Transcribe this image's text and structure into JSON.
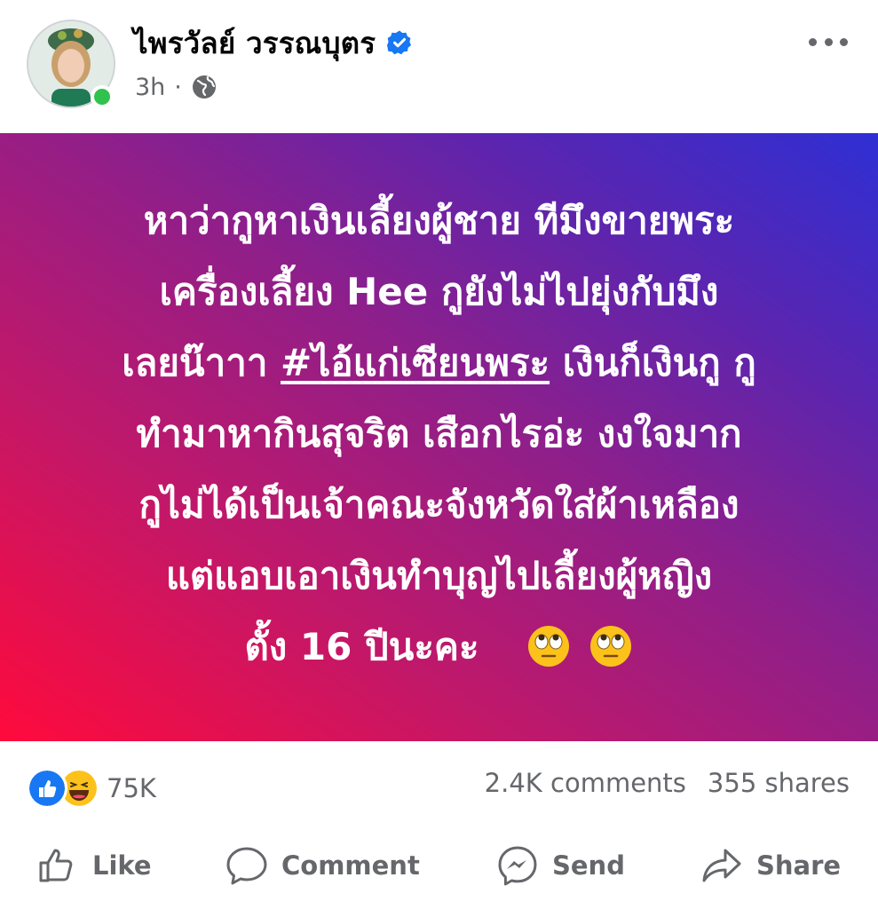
{
  "header": {
    "author_name": "ไพรวัลย์ วรรณบุตร",
    "time": "3h",
    "separator": "·",
    "icons": {
      "verified": "verified-badge-icon",
      "audience": "globe-icon",
      "more": "more-options-icon"
    },
    "colors": {
      "verified": "#1877f2",
      "online": "#31c24d"
    }
  },
  "post": {
    "lines": [
      "หาว่ากูหาเงินเลี้ยงผู้ชาย ทีมึงขายพระ",
      "เครื่องเลี้ยง Hee กูยังไม่ไปยุ่งกับมึง",
      "เลยน๊าาา",
      "#ไอ้แก่เซียนพระ",
      "เงินก็เงินกู กู",
      "ทำมาหากินสุจริต เสือกไรอ่ะ งงใจมาก",
      "กูไม่ได้เป็นเจ้าคณะจังหวัดใส่ผ้าเหลือง",
      "แต่แอบเอาเงินทำบุญไปเลี้ยงผู้หญิง",
      "ตั้ง 16 ปีนะคะ"
    ],
    "emojis": [
      "face-with-rolling-eyes-icon",
      "face-with-rolling-eyes-icon"
    ],
    "background_gradient": [
      "#ff0a3c",
      "#c0186a",
      "#8f1f8a",
      "#5a25b0",
      "#2f2fd4"
    ]
  },
  "stats": {
    "reaction_count": "75K",
    "comments": "2.4K comments",
    "shares": "355 shares",
    "reaction_icons": [
      "like-reaction-icon",
      "haha-reaction-icon"
    ]
  },
  "actions": {
    "like": "Like",
    "comment": "Comment",
    "send": "Send",
    "share": "Share"
  }
}
